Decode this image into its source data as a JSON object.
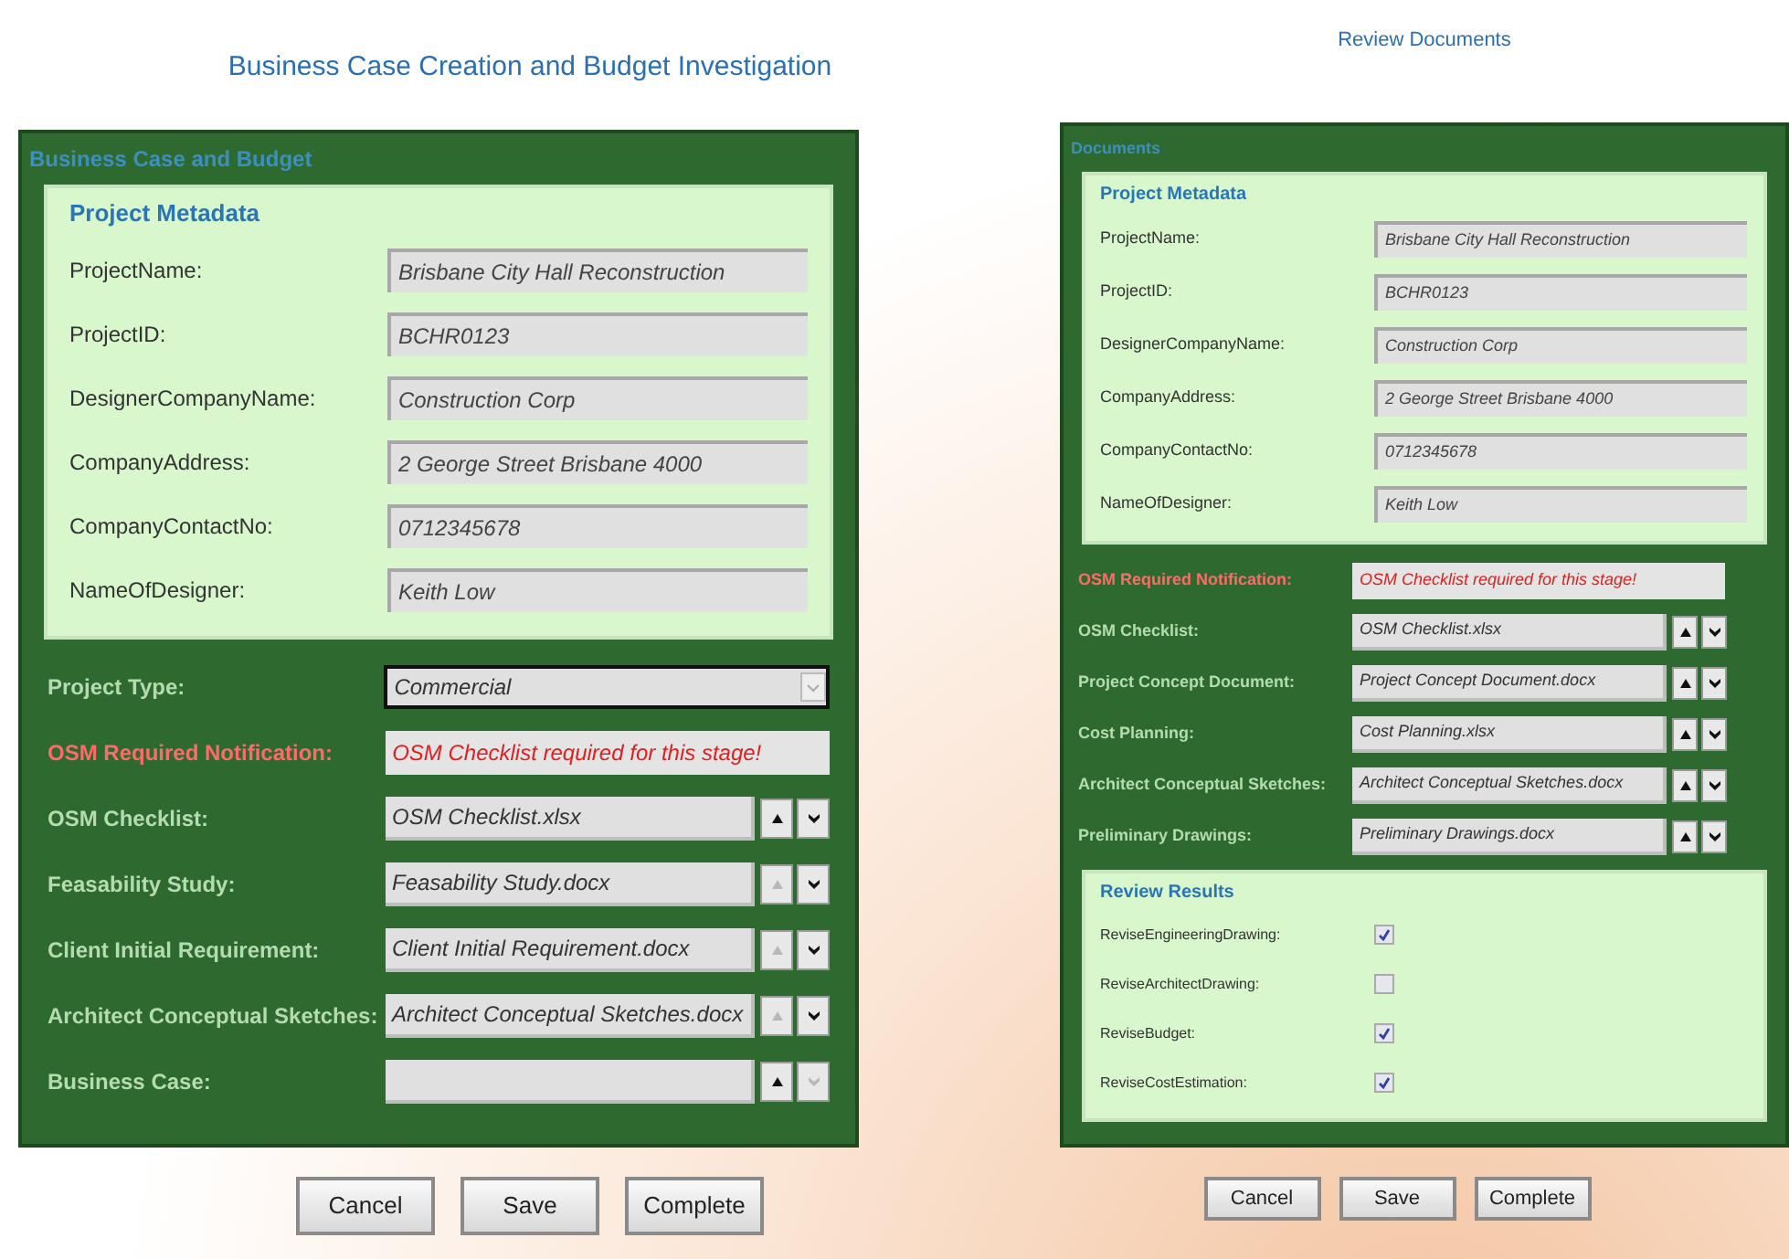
{
  "screens": [
    {
      "title": "Business Case Creation and Budget Investigation",
      "panel_title": "Business Case and Budget",
      "metadata": {
        "title": "Project Metadata",
        "fields": [
          {
            "label": "ProjectName:",
            "value": "Brisbane City Hall Reconstruction"
          },
          {
            "label": "ProjectID:",
            "value": "BCHR0123"
          },
          {
            "label": "DesignerCompanyName:",
            "value": "Construction Corp"
          },
          {
            "label": "CompanyAddress:",
            "value": "2 George Street Brisbane 4000"
          },
          {
            "label": "CompanyContactNo:",
            "value": "0712345678"
          },
          {
            "label": "NameOfDesigner:",
            "value": "Keith Low"
          }
        ]
      },
      "project_type": {
        "label": "Project Type:",
        "value": "Commercial"
      },
      "notification": {
        "label": "OSM Required Notification:",
        "value": "OSM Checklist required for this stage!"
      },
      "documents": [
        {
          "label": "OSM Checklist:",
          "value": "OSM Checklist.xlsx",
          "up_disabled": false,
          "down_disabled": false
        },
        {
          "label": "Feasability Study:",
          "value": "Feasability Study.docx",
          "up_disabled": true,
          "down_disabled": false
        },
        {
          "label": "Client Initial Requirement:",
          "value": "Client Initial Requirement.docx",
          "up_disabled": true,
          "down_disabled": false
        },
        {
          "label": "Architect Conceptual Sketches:",
          "value": "Architect Conceptual Sketches.docx",
          "up_disabled": true,
          "down_disabled": false
        },
        {
          "label": "Business Case:",
          "up_disabled": false,
          "down_disabled": true
        }
      ],
      "buttons": [
        "Cancel",
        "Save",
        "Complete"
      ]
    },
    {
      "title": "Review Documents",
      "panel_title": "Documents",
      "metadata": {
        "title": "Project Metadata",
        "fields": [
          {
            "label": "ProjectName:",
            "value": "Brisbane City Hall Reconstruction"
          },
          {
            "label": "ProjectID:",
            "value": "BCHR0123"
          },
          {
            "label": "DesignerCompanyName:",
            "value": "Construction Corp"
          },
          {
            "label": "CompanyAddress:",
            "value": "2 George Street Brisbane 4000"
          },
          {
            "label": "CompanyContactNo:",
            "value": "0712345678"
          },
          {
            "label": "NameOfDesigner:",
            "value": "Keith Low"
          }
        ]
      },
      "notification": {
        "label": "OSM Required Notification:",
        "value": "OSM Checklist required for this stage!"
      },
      "documents": [
        {
          "label": "OSM Checklist:",
          "value": "OSM Checklist.xlsx",
          "up_disabled": false,
          "down_disabled": false
        },
        {
          "label": "Project Concept Document:",
          "value": "Project Concept Document.docx",
          "up_disabled": false,
          "down_disabled": false
        },
        {
          "label": "Cost Planning:",
          "value": "Cost Planning.xlsx",
          "up_disabled": false,
          "down_disabled": false
        },
        {
          "label": "Architect Conceptual Sketches:",
          "value": "Architect Conceptual Sketches.docx",
          "up_disabled": false,
          "down_disabled": false
        },
        {
          "label": "Preliminary Drawings:",
          "value": "Preliminary Drawings.docx",
          "up_disabled": false,
          "down_disabled": false
        }
      ],
      "review": {
        "title": "Review Results",
        "items": [
          {
            "label": "ReviseEngineeringDrawing:",
            "checked": true
          },
          {
            "label": "ReviseArchitectDrawing:",
            "checked": false
          },
          {
            "label": "ReviseBudget:",
            "checked": true
          },
          {
            "label": "ReviseCostEstimation:",
            "checked": true
          }
        ]
      },
      "buttons": [
        "Cancel",
        "Save",
        "Complete"
      ]
    }
  ]
}
